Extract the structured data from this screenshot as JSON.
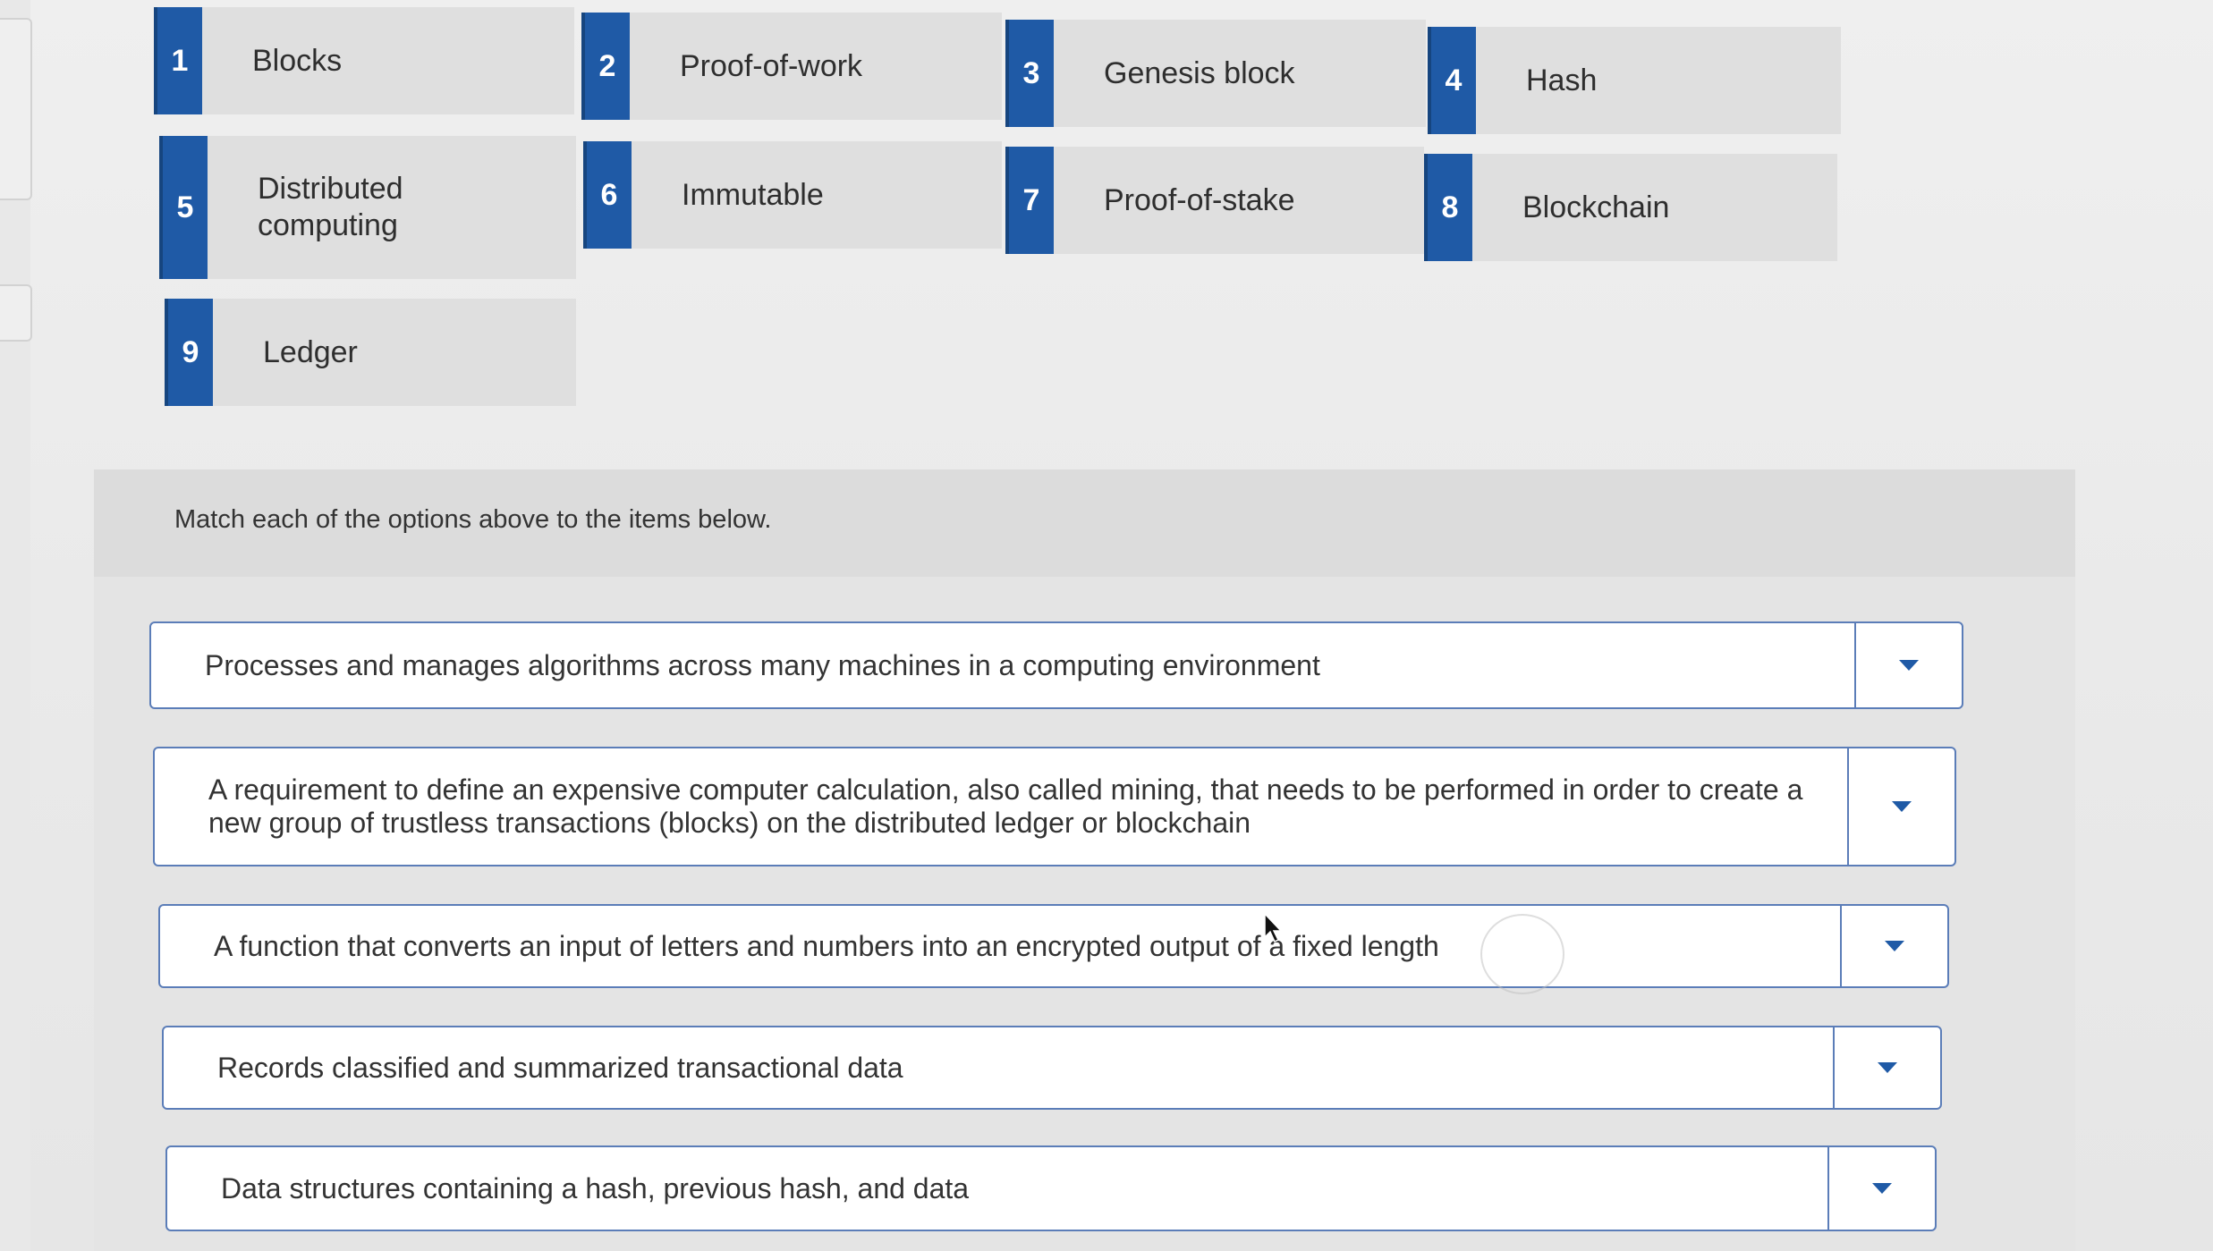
{
  "options": [
    {
      "number": "1",
      "label": "Blocks"
    },
    {
      "number": "2",
      "label": "Proof-of-work"
    },
    {
      "number": "3",
      "label": "Genesis block"
    },
    {
      "number": "4",
      "label": "Hash"
    },
    {
      "number": "5",
      "label": "Distributed computing"
    },
    {
      "number": "6",
      "label": "Immutable"
    },
    {
      "number": "7",
      "label": "Proof-of-stake"
    },
    {
      "number": "8",
      "label": "Blockchain"
    },
    {
      "number": "9",
      "label": "Ledger"
    }
  ],
  "instruction": "Match each of the options above to the items below.",
  "items": [
    {
      "text": "Processes and manages algorithms across many machines in a computing environment",
      "selected": ""
    },
    {
      "text": "A requirement to define an expensive computer calculation, also called mining, that needs to be performed in order to create a new group of trustless transactions (blocks) on the distributed ledger or blockchain",
      "selected": ""
    },
    {
      "text": "A function that converts an input of letters and numbers into an encrypted output of a fixed length",
      "selected": ""
    },
    {
      "text": "Records classified and summarized transactional data",
      "selected": ""
    },
    {
      "text": "Data structures containing a hash, previous hash, and data",
      "selected": ""
    }
  ],
  "icons": {
    "dropdown": "chevron-down-icon",
    "cursor": "mouse-pointer-icon"
  },
  "colors": {
    "accent": "#1f5aa6",
    "border": "#5b7db8"
  }
}
